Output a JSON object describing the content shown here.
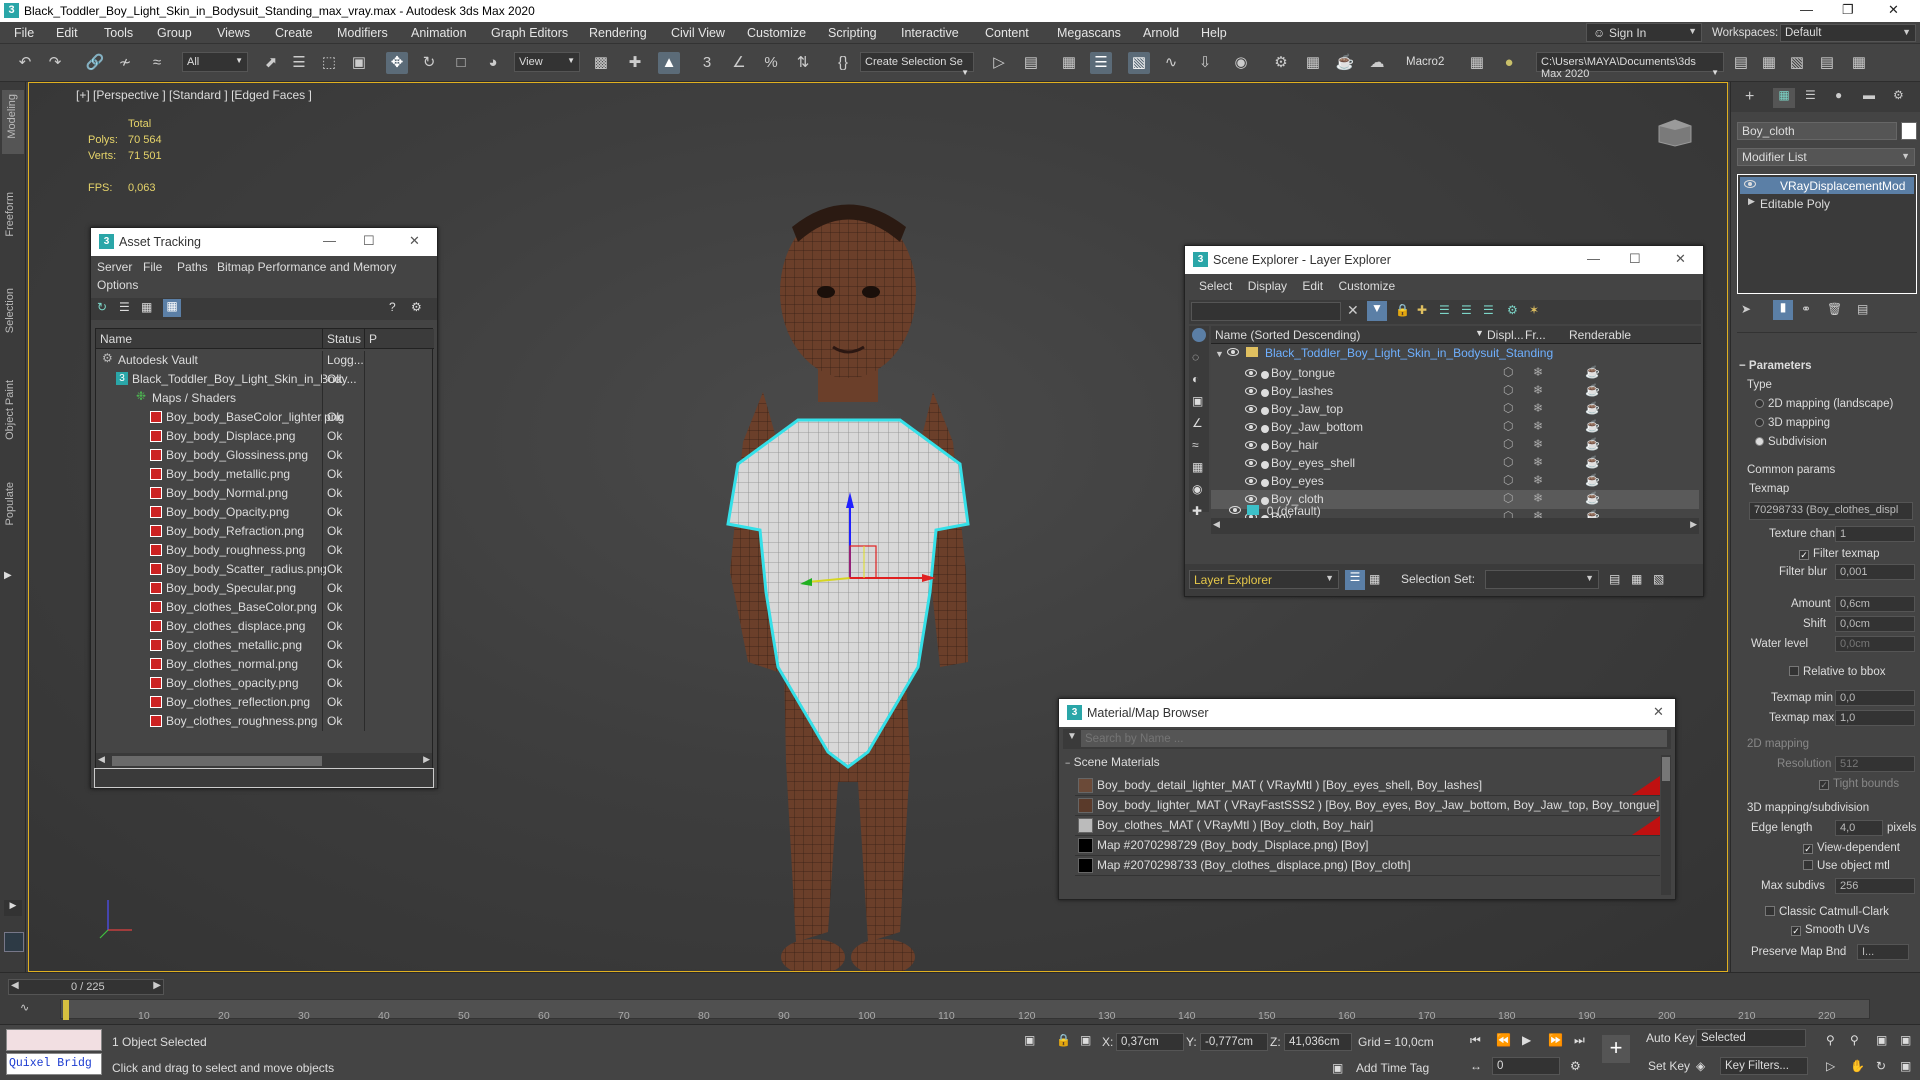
{
  "window": {
    "title": "Black_Toddler_Boy_Light_Skin_in_Bodysuit_Standing_max_vray.max - Autodesk 3ds Max 2020"
  },
  "menu": [
    "File",
    "Edit",
    "Tools",
    "Group",
    "Views",
    "Create",
    "Modifiers",
    "Animation",
    "Graph Editors",
    "Rendering",
    "Civil View",
    "Customize",
    "Scripting",
    "Interactive",
    "Content",
    "Megascans",
    "Arnold",
    "Help"
  ],
  "account": {
    "signin": "Sign In",
    "workspaces_label": "Workspaces:",
    "workspace": "Default"
  },
  "toolbar": {
    "filter": "All",
    "view": "View",
    "selection_set": "Create Selection Se",
    "macro": "Macro2",
    "path": "C:\\Users\\MAYA\\Documents\\3ds Max 2020"
  },
  "left_tabs": [
    "Modeling",
    "Freeform",
    "Selection",
    "Object Paint",
    "Populate"
  ],
  "viewport": {
    "label": "[+] [Perspective ] [Standard ] [Edged Faces ]",
    "stats_header": "Total",
    "polys_label": "Polys:",
    "polys": "70 564",
    "verts_label": "Verts:",
    "verts": "71 501",
    "fps_label": "FPS:",
    "fps": "0,063"
  },
  "asset_tracking": {
    "title": "Asset Tracking",
    "menu": [
      "Server",
      "File",
      "Paths",
      "Bitmap Performance and Memory"
    ],
    "menu2": "Options",
    "col_name": "Name",
    "col_status": "Status",
    "col_p": "P",
    "rows": [
      {
        "name": "Autodesk Vault",
        "status": "Logg..."
      },
      {
        "name": "Black_Toddler_Boy_Light_Skin_in_Body...",
        "status": "Ok"
      },
      {
        "name": "Maps / Shaders",
        "status": ""
      },
      {
        "name": "Boy_body_BaseColor_lighter.png",
        "status": "Ok"
      },
      {
        "name": "Boy_body_Displace.png",
        "status": "Ok"
      },
      {
        "name": "Boy_body_Glossiness.png",
        "status": "Ok"
      },
      {
        "name": "Boy_body_metallic.png",
        "status": "Ok"
      },
      {
        "name": "Boy_body_Normal.png",
        "status": "Ok"
      },
      {
        "name": "Boy_body_Opacity.png",
        "status": "Ok"
      },
      {
        "name": "Boy_body_Refraction.png",
        "status": "Ok"
      },
      {
        "name": "Boy_body_roughness.png",
        "status": "Ok"
      },
      {
        "name": "Boy_body_Scatter_radius.png",
        "status": "Ok"
      },
      {
        "name": "Boy_body_Specular.png",
        "status": "Ok"
      },
      {
        "name": "Boy_clothes_BaseColor.png",
        "status": "Ok"
      },
      {
        "name": "Boy_clothes_displace.png",
        "status": "Ok"
      },
      {
        "name": "Boy_clothes_metallic.png",
        "status": "Ok"
      },
      {
        "name": "Boy_clothes_normal.png",
        "status": "Ok"
      },
      {
        "name": "Boy_clothes_opacity.png",
        "status": "Ok"
      },
      {
        "name": "Boy_clothes_reflection.png",
        "status": "Ok"
      },
      {
        "name": "Boy_clothes_roughness.png",
        "status": "Ok"
      }
    ]
  },
  "scene_explorer": {
    "title": "Scene Explorer - Layer Explorer",
    "menu": [
      "Select",
      "Display",
      "Edit",
      "Customize"
    ],
    "col_name": "Name (Sorted Descending)",
    "col_disp": "Displ...",
    "col_fr": "Fr...",
    "col_render": "Renderable",
    "root": "Black_Toddler_Boy_Light_Skin_in_Bodysuit_Standing",
    "items": [
      "Boy_tongue",
      "Boy_lashes",
      "Boy_Jaw_top",
      "Boy_Jaw_bottom",
      "Boy_hair",
      "Boy_eyes_shell",
      "Boy_eyes",
      "Boy_cloth",
      "Boy"
    ],
    "default_layer": "0 (default)",
    "footer_dropdown": "Layer Explorer",
    "selection_set_label": "Selection Set:"
  },
  "material_browser": {
    "title": "Material/Map Browser",
    "search_placeholder": "Search by Name ...",
    "section": "Scene Materials",
    "rows": [
      "Boy_body_detail_lighter_MAT ( VRayMtl ) [Boy_eyes_shell, Boy_lashes]",
      "Boy_body_lighter_MAT ( VRayFastSSS2 ) [Boy, Boy_eyes, Boy_Jaw_bottom, Boy_Jaw_top, Boy_tongue]",
      "Boy_clothes_MAT ( VRayMtl ) [Boy_cloth, Boy_hair]",
      "Map #2070298729 (Boy_body_Displace.png) [Boy]",
      "Map #2070298733 (Boy_clothes_displace.png) [Boy_cloth]"
    ]
  },
  "command_panel": {
    "object_name": "Boy_cloth",
    "modifier_list": "Modifier List",
    "stack": [
      "VRayDisplacementMod",
      "Editable Poly"
    ],
    "rollout": "Parameters",
    "type_label": "Type",
    "types": [
      "2D mapping (landscape)",
      "3D mapping",
      "Subdivision"
    ],
    "common_params": "Common params",
    "texmap_label": "Texmap",
    "texmap": "70298733 (Boy_clothes_displ",
    "texture_chan_label": "Texture chan",
    "texture_chan": "1",
    "filter_texmap": "Filter texmap",
    "filter_blur_label": "Filter blur",
    "filter_blur": "0,001",
    "amount_label": "Amount",
    "amount": "0,6cm",
    "shift_label": "Shift",
    "shift": "0,0cm",
    "water_label": "Water level",
    "water": "0,0cm",
    "relative_bbox": "Relative to bbox",
    "texmap_min_label": "Texmap min",
    "texmap_min": "0,0",
    "texmap_max_label": "Texmap max",
    "texmap_max": "1,0",
    "mapping2d": "2D mapping",
    "resolution_label": "Resolution",
    "resolution": "512",
    "tight_bounds": "Tight bounds",
    "mapping3d": "3D mapping/subdivision",
    "edge_length_label": "Edge length",
    "edge_length": "4,0",
    "pixels": "pixels",
    "view_dependent": "View-dependent",
    "use_object_mtl": "Use object mtl",
    "max_subdivs_label": "Max subdivs",
    "max_subdivs": "256",
    "classic_catmull": "Classic Catmull-Clark",
    "smooth_uvs": "Smooth UVs",
    "preserve_label": "Preserve Map Bnd",
    "preserve": "I..."
  },
  "timeline": {
    "frame": "0 / 225",
    "ticks": [
      "10",
      "20",
      "30",
      "40",
      "50",
      "60",
      "70",
      "80",
      "90",
      "100",
      "110",
      "120",
      "130",
      "140",
      "150",
      "160",
      "170",
      "180",
      "190",
      "200",
      "210",
      "220"
    ]
  },
  "status": {
    "maxscript": "Quixel Bridg",
    "selected": "1 Object Selected",
    "prompt": "Click and drag to select and move objects",
    "x_label": "X:",
    "x": "0,37cm",
    "y_label": "Y:",
    "y": "-0,777cm",
    "z_label": "Z:",
    "z": "41,036cm",
    "grid": "Grid = 10,0cm",
    "add_time_tag": "Add Time Tag",
    "auto_key": "Auto Key",
    "selected_dd": "Selected",
    "set_key": "Set Key",
    "key_filters": "Key Filters...",
    "frame_field": "0"
  }
}
